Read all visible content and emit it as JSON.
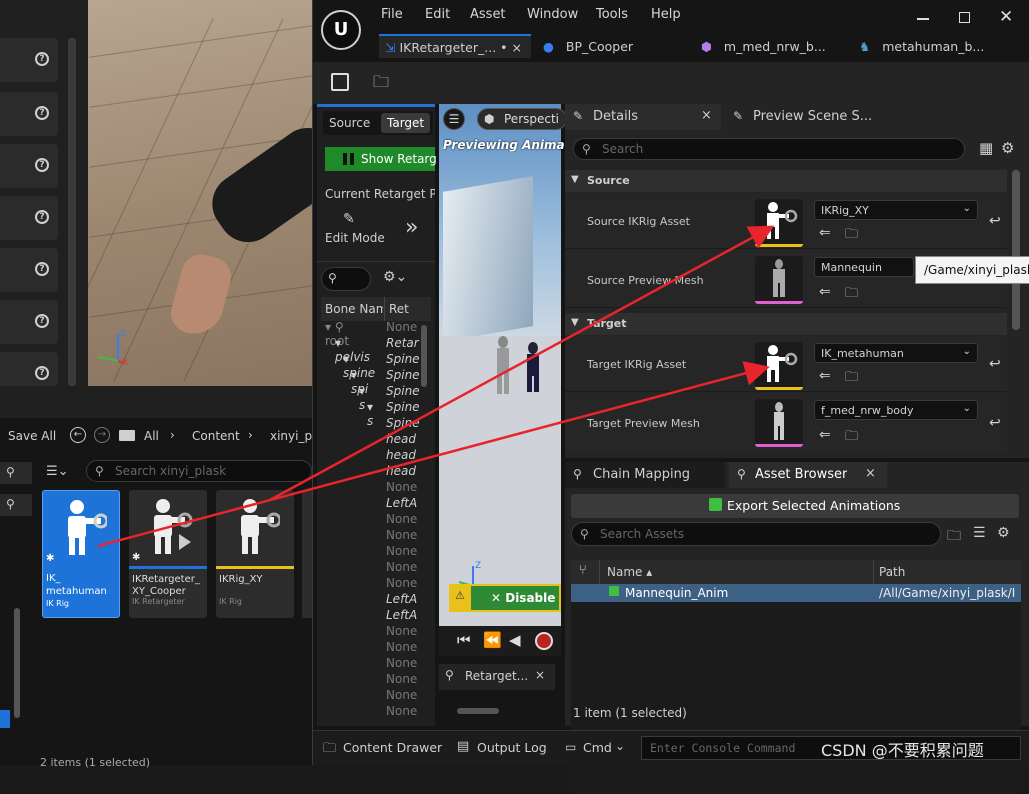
{
  "left_panel": {
    "toolbar": {
      "save_all": "Save All",
      "all": "All",
      "content": "Content",
      "folder": "xinyi_p"
    },
    "search_placeholder": "Search xinyi_plask",
    "assets": [
      {
        "name_line1": "IK_",
        "name_line2": "metahuman",
        "type": "IK Rig"
      },
      {
        "name_line1": "IKRetargeter_",
        "name_line2": "XY_Cooper",
        "type": "IK Retargeter"
      },
      {
        "name_line1": "IKRig_XY",
        "name_line2": "",
        "type": "IK Rig"
      }
    ],
    "status": "2 items (1 selected)"
  },
  "menu": {
    "file": "File",
    "edit": "Edit",
    "asset": "Asset",
    "window": "Window",
    "tools": "Tools",
    "help": "Help"
  },
  "tabs": [
    {
      "label": "IKRetargeter_...",
      "modified": "•",
      "close": "×"
    },
    {
      "label": "BP_Cooper"
    },
    {
      "label": "m_med_nrw_b..."
    },
    {
      "label": "metahuman_b..."
    }
  ],
  "retarget_panel": {
    "source_tab": "Source",
    "target_tab": "Target",
    "show_button": "Show Retarg",
    "current_pose": "Current Retarget Po",
    "edit_mode": "Edit Mode",
    "col_bone": "Bone Nam",
    "col_ret": "Ret",
    "bones": [
      "root",
      "pelvis",
      "spine",
      "spi",
      "s",
      "s"
    ],
    "ret_values": [
      "None",
      "Retar",
      "Spine",
      "Spine",
      "Spine",
      "Spine",
      "Spine",
      "head",
      "head",
      "head",
      "None",
      "LeftA",
      "None",
      "None",
      "None",
      "None",
      "None",
      "LeftA",
      "LeftA",
      "None",
      "None",
      "None",
      "None",
      "None",
      "None"
    ]
  },
  "viewport": {
    "perspective": "Perspecti",
    "previewing": "Previewing Animatio",
    "disable_button": "Disable",
    "retarget_tab": "Retarget..."
  },
  "details": {
    "tab_details": "Details",
    "tab_preview": "Preview Scene S...",
    "search_placeholder": "Search",
    "source_section": "Source",
    "target_section": "Target",
    "rows": [
      {
        "label": "Source IKRig Asset",
        "value": "IKRig_XY"
      },
      {
        "label": "Source Preview Mesh",
        "value": "Mannequin"
      },
      {
        "label": "Target IKRig Asset",
        "value": "IK_metahuman"
      },
      {
        "label": "Target Preview Mesh",
        "value": "f_med_nrw_body"
      }
    ],
    "tooltip": "/Game/xinyi_plask/"
  },
  "asset_browser": {
    "tab_chain": "Chain Mapping",
    "tab_browser": "Asset Browser",
    "export_button": "Export Selected Animations",
    "search_placeholder": "Search Assets",
    "col_name": "Name",
    "col_path": "Path",
    "row": {
      "name": "Mannequin_Anim",
      "path": "/All/Game/xinyi_plask/I"
    },
    "status": "1 item (1 selected)"
  },
  "bottom_bar": {
    "content_drawer": "Content Drawer",
    "output_log": "Output Log",
    "cmd": "Cmd",
    "console_placeholder": "Enter Console Command",
    "watermark": "CSDN @不要积累问题"
  },
  "colors": {
    "accent_blue": "#1e73d8",
    "ikrig_yellow": "#e8c21a",
    "red_arrow": "#e8242c",
    "green_button": "#1f8a2a"
  }
}
